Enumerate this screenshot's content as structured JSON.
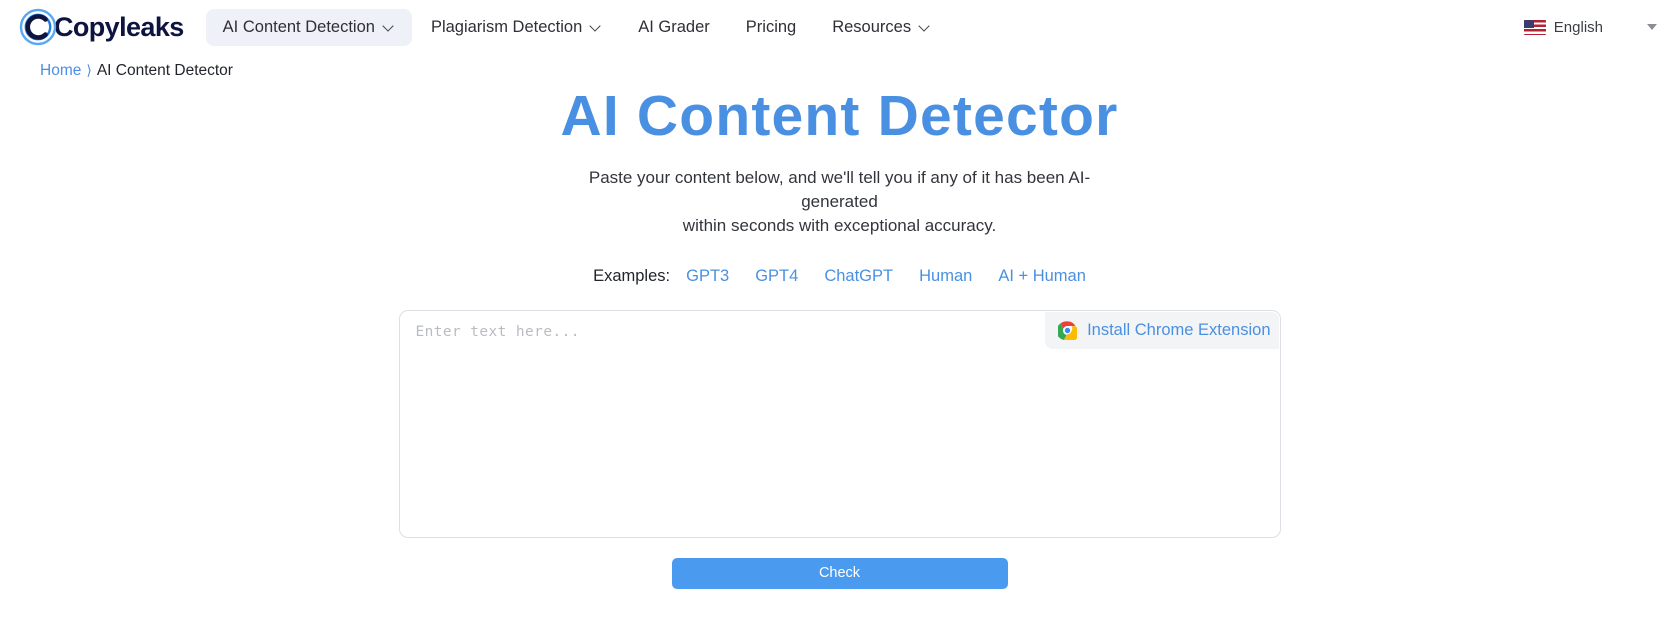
{
  "header": {
    "logo_text": "Copyleaks",
    "logo_icon": "copyleaks-ring-logo",
    "nav": [
      {
        "label": "AI Content Detection",
        "has_caret": true,
        "active": true
      },
      {
        "label": "Plagiarism Detection",
        "has_caret": true,
        "active": false
      },
      {
        "label": "AI Grader",
        "has_caret": false,
        "active": false
      },
      {
        "label": "Pricing",
        "has_caret": false,
        "active": false
      },
      {
        "label": "Resources",
        "has_caret": true,
        "active": false
      }
    ],
    "language": {
      "label": "English",
      "flag_icon": "us-flag-icon",
      "caret_icon": "chevron-down-icon"
    }
  },
  "breadcrumb": {
    "home": "Home",
    "separator": "⟩",
    "current": "AI Content Detector"
  },
  "main": {
    "title": "AI Content Detector",
    "subtitle_line1": "Paste your content below, and we'll tell you if any of it has been AI-generated",
    "subtitle_line2": "within seconds with exceptional accuracy.",
    "examples_label": "Examples:",
    "examples": [
      "GPT3",
      "GPT4",
      "ChatGPT",
      "Human",
      "AI + Human"
    ],
    "editor": {
      "placeholder": "Enter text here...",
      "value": "",
      "chrome_extension_label": "Install Chrome Extension",
      "chrome_icon": "chrome-icon"
    },
    "check_label": "Check"
  },
  "colors": {
    "accent_blue": "#4a90e2",
    "button_blue": "#4a9bf0",
    "logo_navy": "#0d1440",
    "nav_active_bg": "#eef1f7"
  }
}
